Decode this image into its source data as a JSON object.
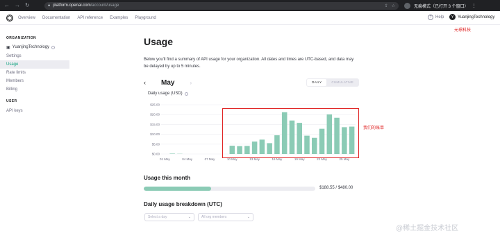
{
  "browser": {
    "url_host": "platform.openai.com",
    "url_path": "/account/usage",
    "incognito_label": "无痕模式（已打开 3 个窗口）"
  },
  "header": {
    "nav": [
      "Overview",
      "Documentation",
      "API reference",
      "Examples",
      "Playground"
    ],
    "help": "Help",
    "account_initial": "Y",
    "account_name": "YuanjingTechnology"
  },
  "annotations": {
    "org_cn": "元璟科技",
    "bill_cn": "我们的账单"
  },
  "sidebar": {
    "org_heading": "ORGANIZATION",
    "org_name": "YuanjingTechnology",
    "items": [
      "Settings",
      "Usage",
      "Rate limits",
      "Members",
      "Billing"
    ],
    "user_heading": "USER",
    "user_items": [
      "API keys"
    ]
  },
  "main": {
    "title": "Usage",
    "intro": "Below you'll find a summary of API usage for your organization. All dates and times are UTC-based, and data may be delayed by up to 5 minutes.",
    "month": "May",
    "toggle": [
      "DAILY",
      "CUMULATIVE"
    ],
    "chart_title": "Daily usage (USD)",
    "usage_heading": "Usage this month",
    "usage_text": "$188.55 / $480.00",
    "usage_fraction": 0.393,
    "breakdown_heading": "Daily usage breakdown (UTC)",
    "select_day": "Select a day",
    "select_members": "All org members"
  },
  "watermark": "@稀土掘金技术社区",
  "chart_data": {
    "type": "bar",
    "title": "Daily usage (USD)",
    "color": "#8bcbb5",
    "ylim": [
      0,
      25
    ],
    "yticks": [
      0,
      5,
      10,
      15,
      20,
      25
    ],
    "ytick_labels": [
      "$0.00",
      "$5.00",
      "$10.00",
      "$15.00",
      "$20.00",
      "$25.00"
    ],
    "xtick_labels": [
      "01 May",
      "04 May",
      "07 May",
      "10 May",
      "13 May",
      "16 May",
      "19 May",
      "22 May",
      "25 May"
    ],
    "xtick_days": [
      1,
      4,
      7,
      10,
      13,
      16,
      19,
      22,
      25
    ],
    "days": [
      1,
      2,
      3,
      4,
      5,
      6,
      7,
      8,
      9,
      10,
      11,
      12,
      13,
      14,
      15,
      16,
      17,
      18,
      19,
      20,
      21,
      22,
      23,
      24,
      25
    ],
    "values": [
      0,
      0.2,
      0.1,
      0,
      0,
      0,
      0,
      0,
      0,
      4.2,
      4.0,
      4.1,
      6.3,
      7.3,
      5.5,
      9.5,
      21.2,
      17.0,
      15.8,
      9.3,
      8.2,
      12.8,
      20.1,
      18.4,
      13.6,
      13.9
    ]
  }
}
